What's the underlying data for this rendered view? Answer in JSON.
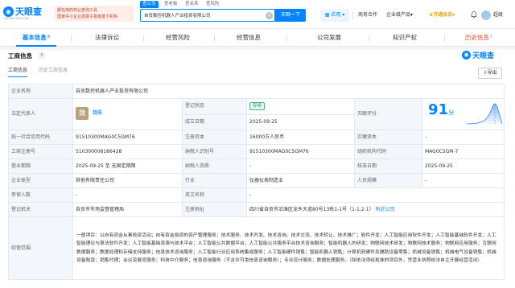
{
  "header": {
    "logo_text": "天眼查",
    "logo_sub": "TianYanCha.com",
    "slogan_line1": "都在用的商业查询工具",
    "slogan_line2": "国家中小企业发展子基金旗下机构",
    "search_tabs": [
      "查公司",
      "查老板",
      "查关系",
      "查风险"
    ],
    "search_value": "自贡数控机器人产业投资有限公司",
    "search_button": "天眼一下",
    "nav_app": "应用",
    "nav_items": [
      "商务合作",
      "企业级产品",
      "开通会员",
      "超级"
    ],
    "colors": {
      "brand": "#0084ff",
      "vip": "#e8a200"
    }
  },
  "main_tabs": [
    {
      "label": "基本信息",
      "count": "8"
    },
    {
      "label": "法律诉讼",
      "count": ""
    },
    {
      "label": "经营风险",
      "count": ""
    },
    {
      "label": "经营信息",
      "count": ""
    },
    {
      "label": "公司发展",
      "count": ""
    },
    {
      "label": "知识产权",
      "count": ""
    },
    {
      "label": "历史信息",
      "count": "5"
    }
  ],
  "section": {
    "title": "工商信息",
    "badge": "8",
    "logo_text": "天眼查",
    "sub_tabs": [
      "工商信息",
      "历史工商信息"
    ],
    "export": "导出"
  },
  "info": {
    "company_name_label": "企业名称",
    "company_name": "自贡数控机器人产业投资有限公司",
    "legal_rep_label": "法定代表人",
    "legal_rep_avatar": "魏",
    "legal_rep": "魏晨",
    "reg_status_label": "登记状态",
    "reg_status": "存续",
    "established_label": "成立日期",
    "established": "2025-09-25",
    "tianyan_score_label": "天眼评分",
    "tianyan_score": "91",
    "tianyan_score_unit": "分",
    "credit_code_label": "统一社会信用代码",
    "credit_code": "91510300MAG0C5GM76",
    "reg_capital_label": "注册资本",
    "reg_capital": "16000万人民币",
    "paid_capital_label": "实缴资本",
    "paid_capital": "-",
    "biz_reg_no_label": "工商注册号",
    "biz_reg_no": "510300008186428",
    "taxpayer_no_label": "纳税人识别号",
    "taxpayer_no": "91510300MAG0C5GM76",
    "org_code_label": "组织机构代码",
    "org_code": "MAG0C5GM-7",
    "term_label": "营业期限",
    "term": "2025-09-25 至 无固定期限",
    "taxpayer_quali_label": "纳税人资质",
    "taxpayer_quali": "-",
    "approval_date_label": "核准日期",
    "approval_date": "2025-09-25",
    "company_type_label": "企业类型",
    "company_type": "其他有限责任公司",
    "industry_label": "行业",
    "industry": "仪器仪表制造业",
    "staff_size_label": "人员规模",
    "staff_size": "-",
    "insured_label": "参保人数",
    "insured": "-",
    "english_name_label": "英文名称",
    "english_name": "-",
    "authority_label": "登记机关",
    "authority": "自贡市市场监督管理局",
    "address_label": "注册地址",
    "address": "四川省自贡市沿滩区龙乡大道80号13栋1-1号（1-1,2-1）",
    "address_link": "附近公司",
    "scope_label": "经营范围",
    "scope": "一般项目：以自有资金从事投资活动；自有资金投资的资产管理服务；技术服务、技术开发、技术咨询、技术交流、技术转让、技术推广；软件开发；人工智能应用软件开发；人工智能基础软件开发；人工智能理论与算法软件开发；人工智能基础资源与技术平台；人工智能公共数据平台；人工智能公共服务平台技术咨询服务；智能机器人的研发；物联网技术研发；物联网技术服务；物联网应用服务；互联网数据服务；数据处理和存储支持服务；信息技术咨询服务；人工智能行业应用系统集成服务；人工智能硬件销售；智能机器人销售；计算机软硬件及辅助设备零售；机械设备销售；机械电气设备销售；机械设备租赁；销售代理；会议及展览服务；科技中介服务；信息咨询服务（不含许可类信息咨询服务）；专业设计服务；数据处理服务。（除依法须经批准的项目外，凭营业执照依法自主开展经营活动）"
  }
}
